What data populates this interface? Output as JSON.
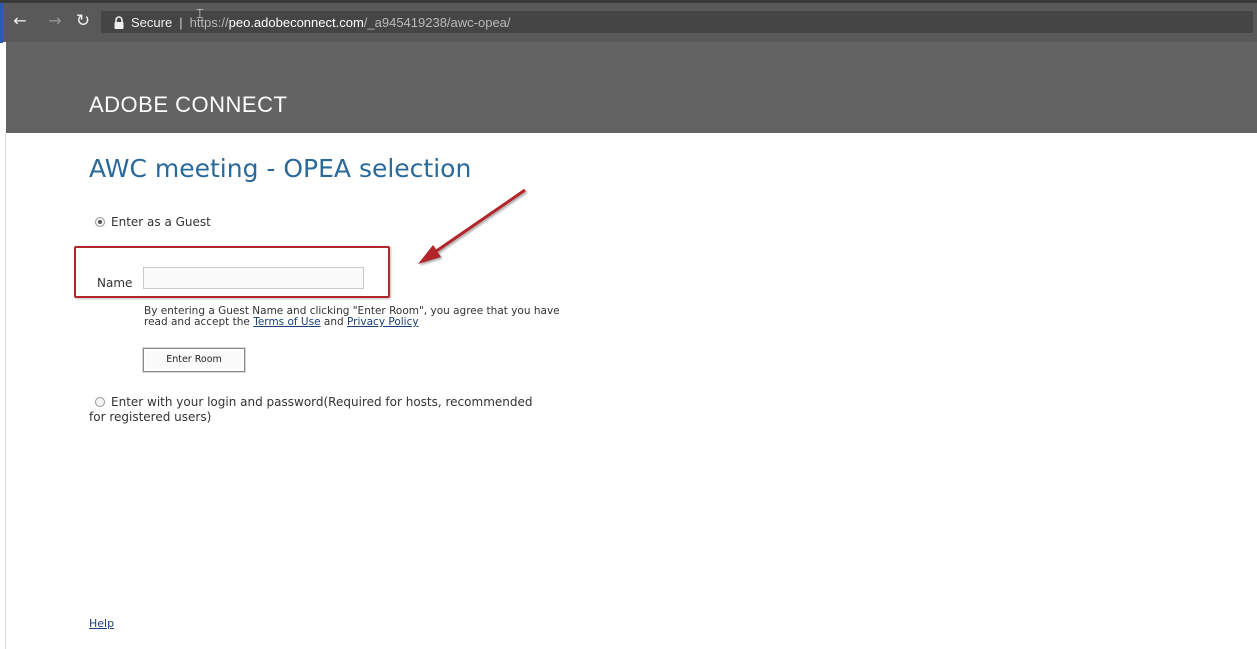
{
  "browser": {
    "secure_label": "Secure",
    "separator": "|",
    "url_scheme": "https://",
    "url_host": "peo.adobeconnect.com",
    "url_path": "/_a945419238/awc-opea/",
    "icons": {
      "back": "back-arrow-icon",
      "forward": "forward-arrow-icon",
      "reload": "reload-icon",
      "lock": "lock-icon"
    }
  },
  "header": {
    "brand": "ADOBE CONNECT"
  },
  "page": {
    "title": "AWC meeting - OPEA selection",
    "guest_option_label": "Enter as a Guest",
    "guest_option_selected": true,
    "name_label": "Name",
    "name_value": "",
    "consent_line1": "By entering a Guest Name and clicking \"Enter Room\", you agree that you have",
    "consent_line2_prefix": "read and accept the",
    "terms_link": "Terms of Use",
    "consent_and": "and",
    "privacy_link": "Privacy Policy",
    "enter_room_button": "Enter Room",
    "login_option_line1": "Enter with your login and password(Required for hosts, recommended",
    "login_option_line2": "for registered users)",
    "login_option_selected": false,
    "help_link": "Help"
  },
  "annotation": {
    "color": "#b2272c"
  }
}
